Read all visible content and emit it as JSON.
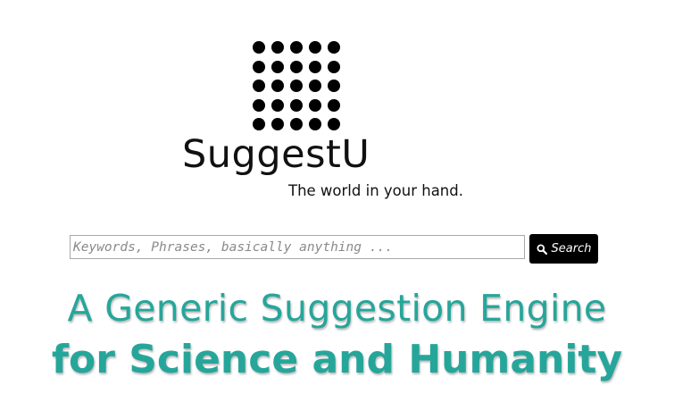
{
  "brand": {
    "name": "SuggestU",
    "tagline": "The world in your hand.",
    "logo_icon": "dot-grid-logo-icon"
  },
  "search": {
    "placeholder": "Keywords, Phrases, basically anything ...",
    "value": "",
    "button_label": "Search",
    "button_icon": "search-icon"
  },
  "headline": {
    "line1": "A Generic Suggestion Engine",
    "line2": "for Science and Humanity"
  },
  "colors": {
    "accent": "#26a69a",
    "button_bg": "#000000",
    "text": "#111111"
  }
}
